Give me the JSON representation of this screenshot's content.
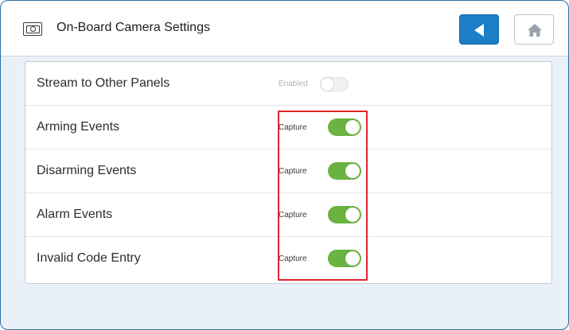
{
  "header": {
    "title": "On-Board Camera Settings",
    "title_icon": "camera-icon",
    "back_icon": "back-arrow-icon",
    "home_icon": "home-icon"
  },
  "settings": [
    {
      "label": "Stream to Other Panels",
      "state_label": "Enabled",
      "on": false
    },
    {
      "label": "Arming Events",
      "state_label": "Capture",
      "on": true
    },
    {
      "label": "Disarming Events",
      "state_label": "Capture",
      "on": true
    },
    {
      "label": "Alarm Events",
      "state_label": "Capture",
      "on": true
    },
    {
      "label": "Invalid Code Entry",
      "state_label": "Capture",
      "on": true
    }
  ],
  "colors": {
    "accent_blue": "#1b7ec7",
    "toggle_on": "#6ab340",
    "highlight_red": "#e0242c"
  }
}
